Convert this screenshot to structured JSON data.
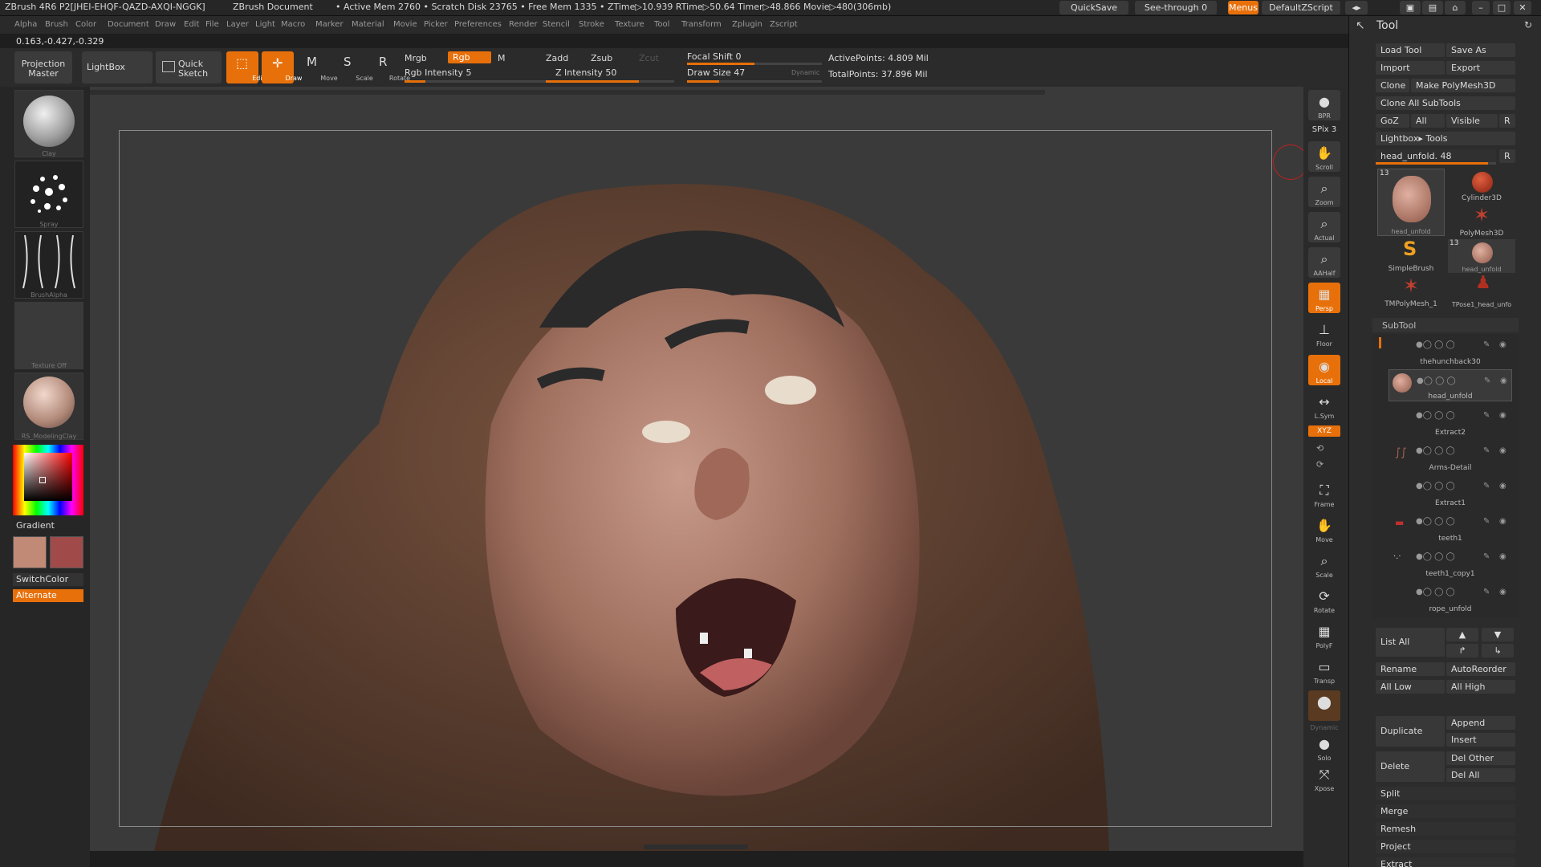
{
  "titlebar": {
    "app": "ZBrush 4R6 P2[JHEI-EHQF-QAZD-AXQI-NGGK]",
    "doc": "ZBrush Document",
    "mem": "• Active Mem 2760 • Scratch Disk 23765 • Free Mem 1335 • ZTime▷10.939 RTime▷50.64 Timer▷48.866 Movie▷480(306mb)",
    "quicksave": "QuickSave",
    "seethrough": "See-through  0",
    "menus": "Menus",
    "script": "DefaultZScript"
  },
  "menubar": [
    "Alpha",
    "Brush",
    "Color",
    "Document",
    "Draw",
    "Edit",
    "File",
    "Layer",
    "Light",
    "Macro",
    "Marker",
    "Material",
    "Movie",
    "Picker",
    "Preferences",
    "Render",
    "Stencil",
    "Stroke",
    "Texture",
    "Tool",
    "Transform",
    "Zplugin",
    "Zscript"
  ],
  "coords": "0.163,-0.427,-0.329",
  "toolbar": {
    "projection": "Projection Master",
    "lightbox": "LightBox",
    "quicksketch": "Quick Sketch",
    "edit": "Edit",
    "draw": "Draw",
    "move": "Move",
    "scale": "Scale",
    "rotate": "Rotate",
    "mrgb": "Mrgb",
    "rgb": "Rgb",
    "m": "M",
    "rgb_intensity": "Rgb Intensity 5",
    "zadd": "Zadd",
    "zsub": "Zsub",
    "zcut": "Zcut",
    "z_intensity": "Z Intensity 50",
    "focal_shift": "Focal Shift 0",
    "draw_size": "Draw Size 47",
    "dynamic": "Dynamic",
    "active_points": "ActivePoints: 4.809 Mil",
    "total_points": "TotalPoints: 37.896 Mil"
  },
  "left": {
    "brush": "Clay",
    "stroke": "Spray",
    "alpha": "BrushAlpha",
    "texture": "Texture Off",
    "material": "RS_ModelingClay",
    "gradient": "Gradient",
    "switchcolor": "SwitchColor",
    "alternate": "Alternate"
  },
  "rightshelf": [
    {
      "label": "BPR",
      "icon": "bpr-icon",
      "orange": false
    },
    {
      "label": "Scroll",
      "icon": "scroll-icon",
      "orange": false
    },
    {
      "label": "Zoom",
      "icon": "zoom-icon",
      "orange": false
    },
    {
      "label": "Actual",
      "icon": "actual-icon",
      "orange": false
    },
    {
      "label": "AAHalf",
      "icon": "aahalf-icon",
      "orange": false
    },
    {
      "label": "Persp",
      "icon": "persp-icon",
      "orange": true
    },
    {
      "label": "Floor",
      "icon": "floor-icon",
      "orange": false
    },
    {
      "label": "Local",
      "icon": "local-icon",
      "orange": true
    },
    {
      "label": "L.Sym",
      "icon": "lsym-icon",
      "orange": false
    },
    {
      "label": "Frame",
      "icon": "frame-icon",
      "orange": false
    },
    {
      "label": "Move",
      "icon": "move-icon",
      "orange": false
    },
    {
      "label": "Scale",
      "icon": "scale-icon",
      "orange": false
    },
    {
      "label": "Rotate",
      "icon": "rotate-icon",
      "orange": false
    },
    {
      "label": "PolyF",
      "icon": "polyf-icon",
      "orange": false
    },
    {
      "label": "Transp",
      "icon": "transp-icon",
      "orange": false
    },
    {
      "label": "Solo",
      "icon": "solo-icon",
      "orange": false
    },
    {
      "label": "Xpose",
      "icon": "xpose-icon",
      "orange": false
    }
  ],
  "spix": "SPix 3",
  "xyz": "XYZ",
  "dynamic_label": "Dynamic",
  "tool": {
    "title": "Tool",
    "load": "Load Tool",
    "saveas": "Save As",
    "import": "Import",
    "export": "Export",
    "clone": "Clone",
    "make_polymesh": "Make PolyMesh3D",
    "clone_all": "Clone All SubTools",
    "goz": "GoZ",
    "all": "All",
    "visible": "Visible",
    "r": "R",
    "lightbox_tools": "Lightbox▸ Tools",
    "current": "head_unfold. 48",
    "thumbs": [
      {
        "name": "head_unfold",
        "count": "13"
      },
      {
        "name": "Cylinder3D",
        "count": ""
      },
      {
        "name": "PolyMesh3D",
        "count": ""
      },
      {
        "name": "SimpleBrush",
        "count": ""
      },
      {
        "name": "head_unfold",
        "count": "13"
      },
      {
        "name": "TMPolyMesh_1",
        "count": ""
      },
      {
        "name": "TPose1_head_unfo",
        "count": ""
      }
    ],
    "subtool_title": "SubTool",
    "subtools": [
      "thehunchback30",
      "head_unfold",
      "Extract2",
      "Arms-Detail",
      "Extract1",
      "teeth1",
      "teeth1_copy1",
      "rope_unfold"
    ],
    "listall": "List All",
    "rename": "Rename",
    "autoreorder": "AutoReorder",
    "alllow": "All Low",
    "allhigh": "All High",
    "duplicate": "Duplicate",
    "append": "Append",
    "insert": "Insert",
    "delete": "Delete",
    "delother": "Del Other",
    "delall": "Del All",
    "split": "Split",
    "merge": "Merge",
    "remesh": "Remesh",
    "project": "Project",
    "extract": "Extract"
  },
  "colors": {
    "accent": "#e8700a",
    "primary": "#c08a76",
    "secondary": "#a04a4a"
  }
}
